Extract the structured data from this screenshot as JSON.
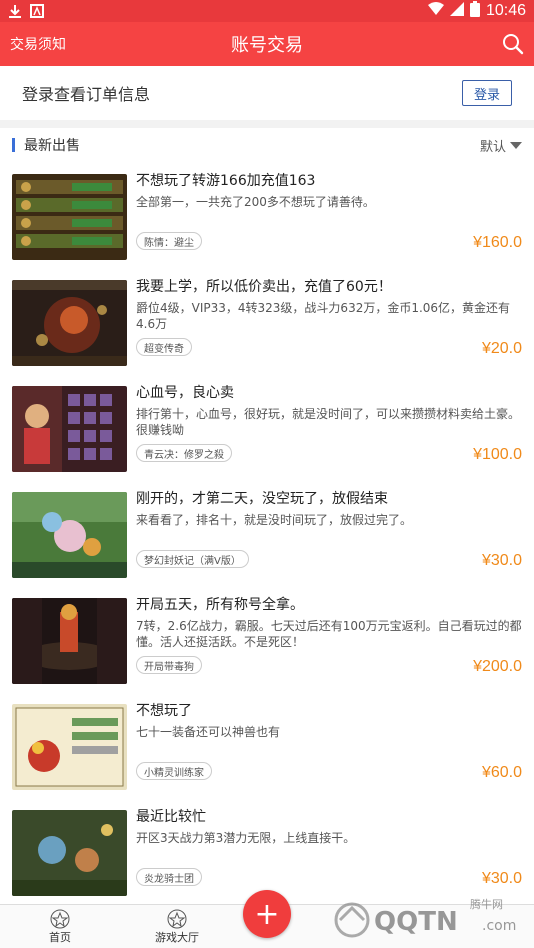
{
  "status_bar": {
    "time": "10:46"
  },
  "header": {
    "left_link": "交易须知",
    "title": "账号交易",
    "search_icon": "search-icon"
  },
  "login_bar": {
    "message": "登录查看订单信息",
    "button": "登录"
  },
  "section": {
    "title": "最新出售",
    "sort": "默认"
  },
  "items": [
    {
      "title": "不想玩了转游166加充值163",
      "desc": "全部第一，一共充了200多不想玩了请善待。",
      "tag": "陈情：避尘",
      "price": "¥160.0"
    },
    {
      "title": "我要上学，所以低价卖出，充值了60元！",
      "desc": "爵位4级，VIP33，4转323级，战斗力632万，金币1.06亿，黄金还有4.6万",
      "tag": "超变传奇",
      "price": "¥20.0"
    },
    {
      "title": "心血号，良心卖",
      "desc": "排行第十，心血号，很好玩，就是没时间了，可以来攒攒材料卖给土豪。很赚钱呦",
      "tag": "青云决：修罗之殺",
      "price": "¥100.0"
    },
    {
      "title": "刚开的，才第二天，没空玩了，放假结束",
      "desc": "来看看了，排名十，就是没时间玩了，放假过完了。",
      "tag": "梦幻封妖记（满V版）",
      "price": "¥30.0"
    },
    {
      "title": "开局五天，所有称号全拿。",
      "desc": "7转，2.6亿战力，霸服。七天过后还有100万元宝返利。自己看玩过的都懂。活人还挺活跃。不是死区！",
      "tag": "开局带毒狗",
      "price": "¥200.0"
    },
    {
      "title": "不想玩了",
      "desc": "七十一装备还可以神兽也有",
      "tag": "小精灵训练家",
      "price": "¥60.0"
    },
    {
      "title": "最近比较忙",
      "desc": "开区3天战力第3潜力无限，上线直接干。",
      "tag": "炎龙骑士团",
      "price": "¥30.0"
    }
  ],
  "bottom_nav": {
    "home": "首页",
    "game_hall": "游戏大厅",
    "fab": "+"
  },
  "colors": {
    "brand_red": "#f54343",
    "price_orange": "#f08a1a",
    "login_blue": "#2b5aa8"
  }
}
